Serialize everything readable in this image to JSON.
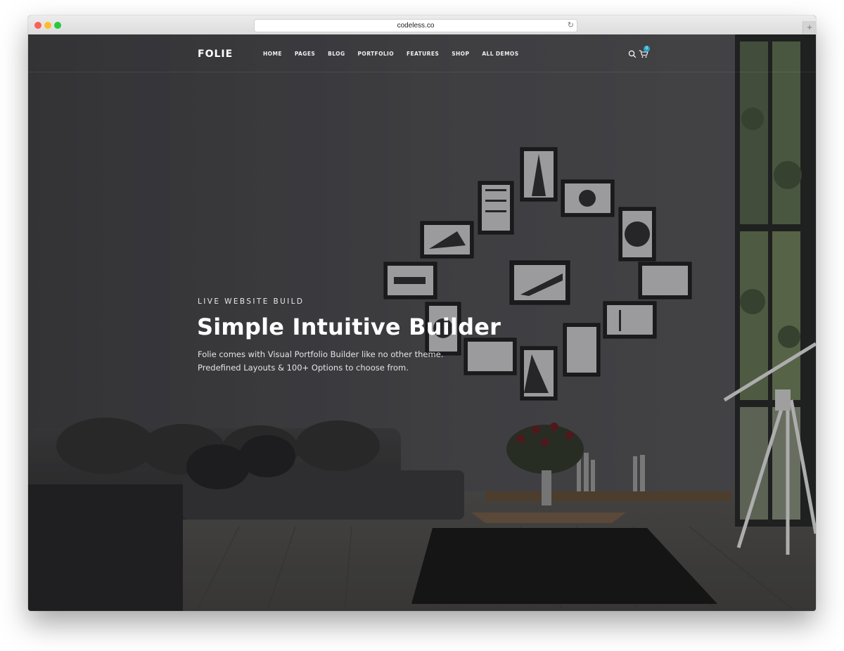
{
  "browser": {
    "url": "codeless.co",
    "new_tab": "+"
  },
  "header": {
    "logo": "FOLIE",
    "menu": [
      "HOME",
      "PAGES",
      "BLOG",
      "PORTFOLIO",
      "FEATURES",
      "SHOP",
      "ALL DEMOS"
    ],
    "cart_count": "0"
  },
  "hero": {
    "eyebrow": "LIVE WEBSITE BUILD",
    "title": "Simple Intuitive Builder",
    "description_line1": "Folie comes with Visual Portfolio Builder like no other theme.",
    "description_line2": "Predefined Layouts & 100+ Options to choose from."
  },
  "icons": {
    "search": "search-icon",
    "cart": "cart-icon",
    "reload": "reload-icon"
  },
  "colors": {
    "accent_badge": "#2aa4c8",
    "scene_wall": "#434347",
    "text": "#ffffff"
  }
}
